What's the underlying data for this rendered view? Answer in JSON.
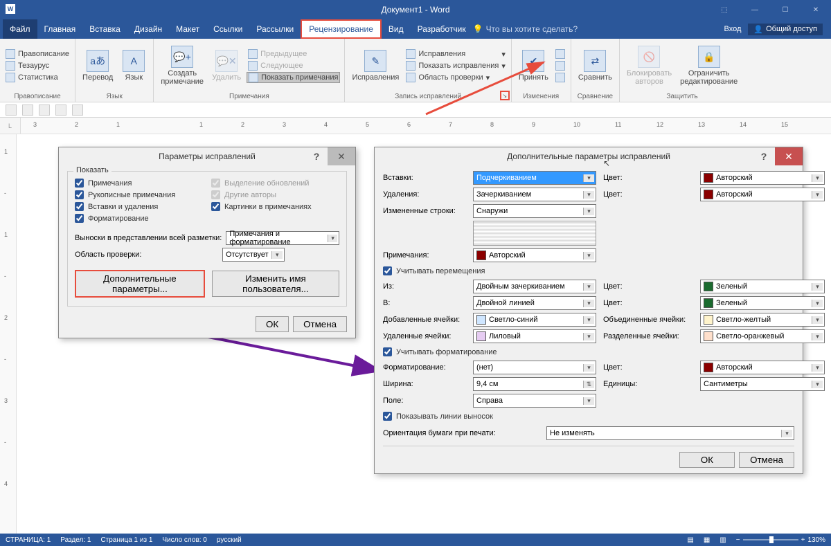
{
  "window": {
    "title": "Документ1 - Word"
  },
  "menu": {
    "file": "Файл",
    "tabs": [
      "Главная",
      "Вставка",
      "Дизайн",
      "Макет",
      "Ссылки",
      "Рассылки",
      "Рецензирование",
      "Вид",
      "Разработчик"
    ],
    "active": "Рецензирование",
    "help": "Что вы хотите сделать?",
    "login": "Вход",
    "share": "Общий доступ"
  },
  "ribbon": {
    "proofing": {
      "label": "Правописание",
      "items": [
        "Правописание",
        "Тезаурус",
        "Статистика"
      ]
    },
    "language": {
      "label": "Язык",
      "translate": "Перевод",
      "lang": "Язык"
    },
    "comments": {
      "label": "Примечания",
      "new": "Создать\nпримечание",
      "del": "Удалить",
      "prev": "Предыдущее",
      "next": "Следующее",
      "show": "Показать примечания"
    },
    "tracking": {
      "label": "Запись исправлений",
      "track": "Исправления",
      "mode": "Исправления",
      "show": "Показать исправления",
      "pane": "Область проверки"
    },
    "changes": {
      "label": "Изменения",
      "accept": "Принять"
    },
    "compare": {
      "label": "Сравнение",
      "cmp": "Сравнить"
    },
    "protect": {
      "label": "Защитить",
      "block": "Блокировать\nавторов",
      "restrict": "Ограничить\nредактирование"
    }
  },
  "dlg1": {
    "title": "Параметры исправлений",
    "show_label": "Показать",
    "c_comments": "Примечания",
    "c_ink": "Рукописные примечания",
    "c_insdel": "Вставки и удаления",
    "c_fmt": "Форматирование",
    "c_upd": "Выделение обновлений",
    "c_oth": "Другие авторы",
    "c_pic": "Картинки в примечаниях",
    "balloons_label": "Выноски в представлении всей разметки:",
    "balloons_val": "Примечания и форматирование",
    "pane_label": "Область проверки:",
    "pane_val": "Отсутствует",
    "adv": "Дополнительные параметры...",
    "user": "Изменить имя пользователя...",
    "ok": "ОК",
    "cancel": "Отмена"
  },
  "dlg2": {
    "title": "Дополнительные параметры исправлений",
    "ins_l": "Вставки:",
    "ins_v": "Подчеркиванием",
    "ins_c_l": "Цвет:",
    "ins_c_v": "Авторский",
    "del_l": "Удаления:",
    "del_v": "Зачеркиванием",
    "del_c_l": "Цвет:",
    "del_c_v": "Авторский",
    "chg_l": "Измененные строки:",
    "chg_v": "Снаружи",
    "com_l": "Примечания:",
    "com_v": "Авторский",
    "track_moves": "Учитывать перемещения",
    "from_l": "Из:",
    "from_v": "Двойным зачеркиванием",
    "from_c_l": "Цвет:",
    "from_c_v": "Зеленый",
    "to_l": "В:",
    "to_v": "Двойной линией",
    "to_c_l": "Цвет:",
    "to_c_v": "Зеленый",
    "addcell_l": "Добавленные ячейки:",
    "addcell_v": "Светло-синий",
    "mergecell_l": "Объединенные ячейки:",
    "mergecell_v": "Светло-желтый",
    "delcell_l": "Удаленные ячейки:",
    "delcell_v": "Лиловый",
    "splitcell_l": "Разделенные ячейки:",
    "splitcell_v": "Светло-оранжевый",
    "track_fmt": "Учитывать форматирование",
    "fmt_l": "Форматирование:",
    "fmt_v": "(нет)",
    "fmt_c_l": "Цвет:",
    "fmt_c_v": "Авторский",
    "width_l": "Ширина:",
    "width_v": "9,4 см",
    "unit_l": "Единицы:",
    "unit_v": "Сантиметры",
    "margin_l": "Поле:",
    "margin_v": "Справа",
    "show_lines": "Показывать линии выносок",
    "orient_l": "Ориентация бумаги при печати:",
    "orient_v": "Не изменять",
    "ok": "ОК",
    "cancel": "Отмена"
  },
  "status": {
    "page": "СТРАНИЦА: 1",
    "section": "Раздел: 1",
    "pages": "Страница 1 из 1",
    "words": "Число слов: 0",
    "lang": "русский",
    "zoom": "130%"
  },
  "colors": {
    "author": "#8b0000",
    "green": "#1b6b2f",
    "lblue": "#cfe6ff",
    "lilac": "#e6ccf2",
    "lyellow": "#fff4cc",
    "lorange": "#ffe0cc"
  }
}
